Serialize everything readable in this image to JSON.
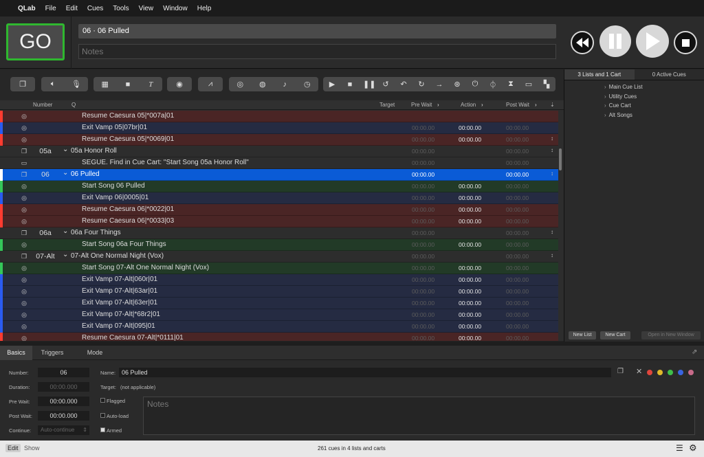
{
  "menubar": {
    "apple_icon": "apple-logo-icon",
    "app": "QLab",
    "items": [
      "File",
      "Edit",
      "Cues",
      "Tools",
      "View",
      "Window",
      "Help"
    ]
  },
  "header": {
    "go_label": "GO",
    "cue_title": "06 · 06 Pulled",
    "notes_placeholder": "Notes",
    "go_border_color": "#2fb82f"
  },
  "cue_table": {
    "columns": [
      "Number",
      "Q",
      "Target",
      "Pre Wait",
      "Action",
      "Post Wait"
    ],
    "rows": [
      {
        "num": "",
        "name": "Resume Caesura 05|*007a|01",
        "pre": "",
        "act": "",
        "post": "",
        "bg": "#4a2525",
        "stripe": "#ff3b30",
        "indent": 2,
        "icon": "target-icon"
      },
      {
        "num": "",
        "name": "Exit Vamp 05|07br|01",
        "pre": "00:00.00",
        "act": "00:00.00",
        "post": "00:00.00",
        "bg": "#252b42",
        "stripe": "#2a5bf0",
        "indent": 2,
        "icon": "target-icon"
      },
      {
        "num": "",
        "name": "Resume Caesura 05|*0069|01",
        "pre": "00:00.00",
        "act": "00:00.00",
        "post": "00:00.00",
        "bg": "#4a2525",
        "stripe": "#ff3b30",
        "indent": 2,
        "icon": "target-icon",
        "grp": "↕"
      },
      {
        "num": "05a",
        "name": "05a Honor Roll",
        "pre": "00:00.00",
        "act": "",
        "post": "00:00.00",
        "bg": "#2d2d2d",
        "stripe": "",
        "indent": 0,
        "icon": "group-icon",
        "chev": "⌄",
        "grp": "↕"
      },
      {
        "num": "",
        "name": "SEGUE. Find in Cue Cart: \"Start Song 05a Honor Roll\"",
        "pre": "00:00.00",
        "act": "",
        "post": "00:00.00",
        "bg": "#2d2d2d",
        "stripe": "",
        "indent": 2,
        "icon": "memo-icon"
      },
      {
        "num": "06",
        "name": "06 Pulled",
        "pre": "00:00.00",
        "act": "",
        "post": "00:00.00",
        "bg": "#0a5bd6",
        "stripe": "#ffffff",
        "indent": 0,
        "icon": "group-icon",
        "chev": "⌄",
        "sel": true,
        "grp": "↕"
      },
      {
        "num": "",
        "name": "Start Song 06 Pulled",
        "pre": "00:00.00",
        "act": "00:00.00",
        "post": "00:00.00",
        "bg": "#223a27",
        "stripe": "#34c759",
        "indent": 2,
        "icon": "target-icon"
      },
      {
        "num": "",
        "name": "Exit Vamp 06|0005|01",
        "pre": "00:00.00",
        "act": "00:00.00",
        "post": "00:00.00",
        "bg": "#252b42",
        "stripe": "#2a5bf0",
        "indent": 2,
        "icon": "target-icon"
      },
      {
        "num": "",
        "name": "Resume Caesura 06|*0022|01",
        "pre": "00:00.00",
        "act": "00:00.00",
        "post": "00:00.00",
        "bg": "#4a2525",
        "stripe": "#ff3b30",
        "indent": 2,
        "icon": "target-icon"
      },
      {
        "num": "",
        "name": "Resume Caesura 06|*0033|03",
        "pre": "00:00.00",
        "act": "00:00.00",
        "post": "00:00.00",
        "bg": "#4a2525",
        "stripe": "#ff3b30",
        "indent": 2,
        "icon": "target-icon"
      },
      {
        "num": "06a",
        "name": "06a Four Things",
        "pre": "00:00.00",
        "act": "",
        "post": "00:00.00",
        "bg": "#2d2d2d",
        "stripe": "",
        "indent": 0,
        "icon": "group-icon",
        "chev": "⌄",
        "grp": "↕"
      },
      {
        "num": "",
        "name": "Start Song 06a Four Things",
        "pre": "00:00.00",
        "act": "00:00.00",
        "post": "00:00.00",
        "bg": "#223a27",
        "stripe": "#34c759",
        "indent": 2,
        "icon": "target-icon"
      },
      {
        "num": "07-Alt",
        "name": "07-Alt One Normal Night (Vox)",
        "pre": "00:00.00",
        "act": "",
        "post": "00:00.00",
        "bg": "#2d2d2d",
        "stripe": "",
        "indent": 0,
        "icon": "group-icon",
        "chev": "⌄",
        "grp": "↕"
      },
      {
        "num": "",
        "name": "Start Song 07-Alt One Normal Night (Vox)",
        "pre": "00:00.00",
        "act": "00:00.00",
        "post": "00:00.00",
        "bg": "#223a27",
        "stripe": "#34c759",
        "indent": 2,
        "icon": "target-icon"
      },
      {
        "num": "",
        "name": "Exit Vamp 07-Alt|060r|01",
        "pre": "00:00.00",
        "act": "00:00.00",
        "post": "00:00.00",
        "bg": "#252b42",
        "stripe": "#2a5bf0",
        "indent": 2,
        "icon": "target-icon"
      },
      {
        "num": "",
        "name": "Exit Vamp 07-Alt|63ar|01",
        "pre": "00:00.00",
        "act": "00:00.00",
        "post": "00:00.00",
        "bg": "#252b42",
        "stripe": "#2a5bf0",
        "indent": 2,
        "icon": "target-icon"
      },
      {
        "num": "",
        "name": "Exit Vamp 07-Alt|63er|01",
        "pre": "00:00.00",
        "act": "00:00.00",
        "post": "00:00.00",
        "bg": "#252b42",
        "stripe": "#2a5bf0",
        "indent": 2,
        "icon": "target-icon"
      },
      {
        "num": "",
        "name": "Exit Vamp 07-Alt|*68r2|01",
        "pre": "00:00.00",
        "act": "00:00.00",
        "post": "00:00.00",
        "bg": "#252b42",
        "stripe": "#2a5bf0",
        "indent": 2,
        "icon": "target-icon"
      },
      {
        "num": "",
        "name": "Exit Vamp 07-Alt|095|01",
        "pre": "00:00.00",
        "act": "00:00.00",
        "post": "00:00.00",
        "bg": "#252b42",
        "stripe": "#2a5bf0",
        "indent": 2,
        "icon": "target-icon"
      },
      {
        "num": "",
        "name": "Resume Caesura 07-Alt|*0111|01",
        "pre": "00:00.00",
        "act": "00:00.00",
        "post": "00:00.00",
        "bg": "#4a2525",
        "stripe": "#ff3b30",
        "indent": 2,
        "icon": "target-icon"
      }
    ]
  },
  "right_panel": {
    "tab_lists": "3 Lists and 1 Cart",
    "tab_active": "0 Active Cues",
    "lists": [
      "Main Cue List",
      "Utility Cues",
      "Cue Cart",
      "Alt Songs"
    ],
    "new_list": "New List",
    "new_cart": "New Cart",
    "open_window": "Open in New Window"
  },
  "inspector": {
    "tabs": [
      "Basics",
      "Triggers",
      "Mode"
    ],
    "number_label": "Number:",
    "number_value": "06",
    "name_label": "Name:",
    "name_value": "06 Pulled",
    "duration_label": "Duration:",
    "duration_value": "00:00.000",
    "target_label": "Target:",
    "target_value": "(not applicable)",
    "prewait_label": "Pre Wait:",
    "prewait_value": "00:00.000",
    "flagged_label": "Flagged",
    "postwait_label": "Post Wait:",
    "postwait_value": "00:00.000",
    "autoload_label": "Auto-load",
    "continue_label": "Continue:",
    "continue_value": "Auto-continue",
    "armed_label": "Armed",
    "notes_placeholder": "Notes",
    "color_dots": [
      "#e0463c",
      "#e0b92a",
      "#3fbf4a",
      "#3a64e0",
      "#c86b8a"
    ]
  },
  "statusbar": {
    "edit": "Edit",
    "show": "Show",
    "summary": "261 cues in 4 lists and carts"
  }
}
